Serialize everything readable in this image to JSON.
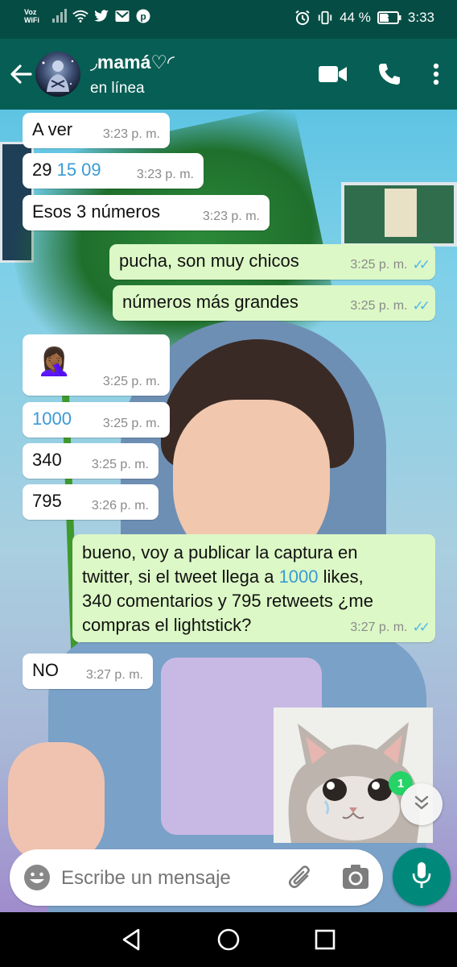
{
  "status_bar": {
    "carrier_line1": "Voz",
    "carrier_line2": "WiFi",
    "battery": "44 %",
    "time": "3:33"
  },
  "header": {
    "contact_name": "◞mamá♡◜",
    "contact_status": "en línea",
    "icons": [
      "back-arrow-icon",
      "video-call-icon",
      "phone-call-icon",
      "more-options-icon"
    ]
  },
  "messages": [
    {
      "dir": "in",
      "text": "A ver",
      "time": "3:23 p. m."
    },
    {
      "dir": "in",
      "text_parts": [
        "29 ",
        "15 09"
      ],
      "time": "3:23 p. m."
    },
    {
      "dir": "in",
      "text": "Esos 3 números",
      "time": "3:23 p. m."
    },
    {
      "dir": "out",
      "text": "pucha, son muy chicos",
      "time": "3:25 p. m.",
      "status": "read"
    },
    {
      "dir": "out",
      "text": "números más grandes",
      "time": "3:25 p. m.",
      "status": "read"
    },
    {
      "dir": "in",
      "text": "🤦🏾‍♀️",
      "time": "3:25 p. m."
    },
    {
      "dir": "in",
      "text": "1000",
      "time": "3:25 p. m."
    },
    {
      "dir": "in",
      "text": "340",
      "time": "3:25 p. m."
    },
    {
      "dir": "in",
      "text": "795",
      "time": "3:26 p. m."
    },
    {
      "dir": "out",
      "lines": [
        "bueno, voy a publicar la captura en",
        "twitter, si el tweet llega a ",
        "1000",
        " likes,",
        "340 comentarios y 795 retweets ¿me",
        "compras el lightstick?"
      ],
      "time": "3:27 p. m.",
      "status": "read"
    },
    {
      "dir": "in",
      "text": "NO",
      "time": "3:27 p. m."
    },
    {
      "dir": "out",
      "type": "sticker",
      "sticker": "crying-cat-sticker"
    }
  ],
  "scroll_down": {
    "unread_count": "1"
  },
  "composer": {
    "placeholder": "Escribe un mensaje",
    "icons": [
      "emoji-icon",
      "attach-icon",
      "camera-icon",
      "mic-icon"
    ]
  },
  "nav": {
    "icons": [
      "back-triangle-icon",
      "home-circle-icon",
      "recents-square-icon"
    ]
  },
  "colors": {
    "status_bar": "#054d44",
    "app_bar": "#075e54",
    "outgoing_bubble": "#dcf8c6",
    "incoming_bubble": "#ffffff",
    "read_ticks": "#4fb6ec",
    "mic_button": "#00897b",
    "link": "#3a9bd5"
  }
}
